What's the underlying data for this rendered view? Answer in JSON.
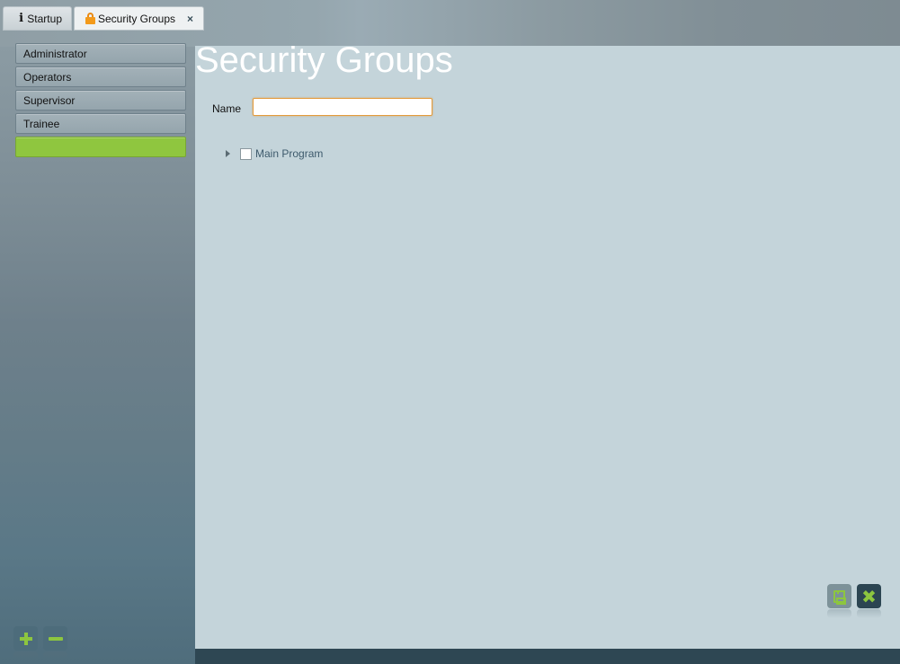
{
  "tabs": [
    {
      "label": "Startup",
      "icon": "info-icon",
      "active": false
    },
    {
      "label": "Security Groups",
      "icon": "lock-icon",
      "active": true,
      "closable": true,
      "close_glyph": "×"
    }
  ],
  "sidebar": {
    "groups": [
      {
        "label": "Administrator"
      },
      {
        "label": "Operators"
      },
      {
        "label": "Supervisor"
      },
      {
        "label": "Trainee"
      },
      {
        "label": "",
        "selected": true
      }
    ],
    "add_icon": "plus-icon",
    "remove_icon": "minus-icon"
  },
  "main": {
    "title": "Security Groups",
    "name_label": "Name",
    "name_value": "",
    "name_placeholder": "",
    "tree": [
      {
        "label": "Main Program",
        "expanded": false,
        "checked": false
      }
    ],
    "actions": {
      "save_icon": "save-icon",
      "cancel_icon": "close-icon",
      "cancel_glyph": "✖"
    }
  },
  "colors": {
    "accent": "#8dc63f",
    "selected_group": "#8fc63f",
    "panel_bg": "#c4d4da",
    "input_focus_border": "#e39a3a"
  }
}
